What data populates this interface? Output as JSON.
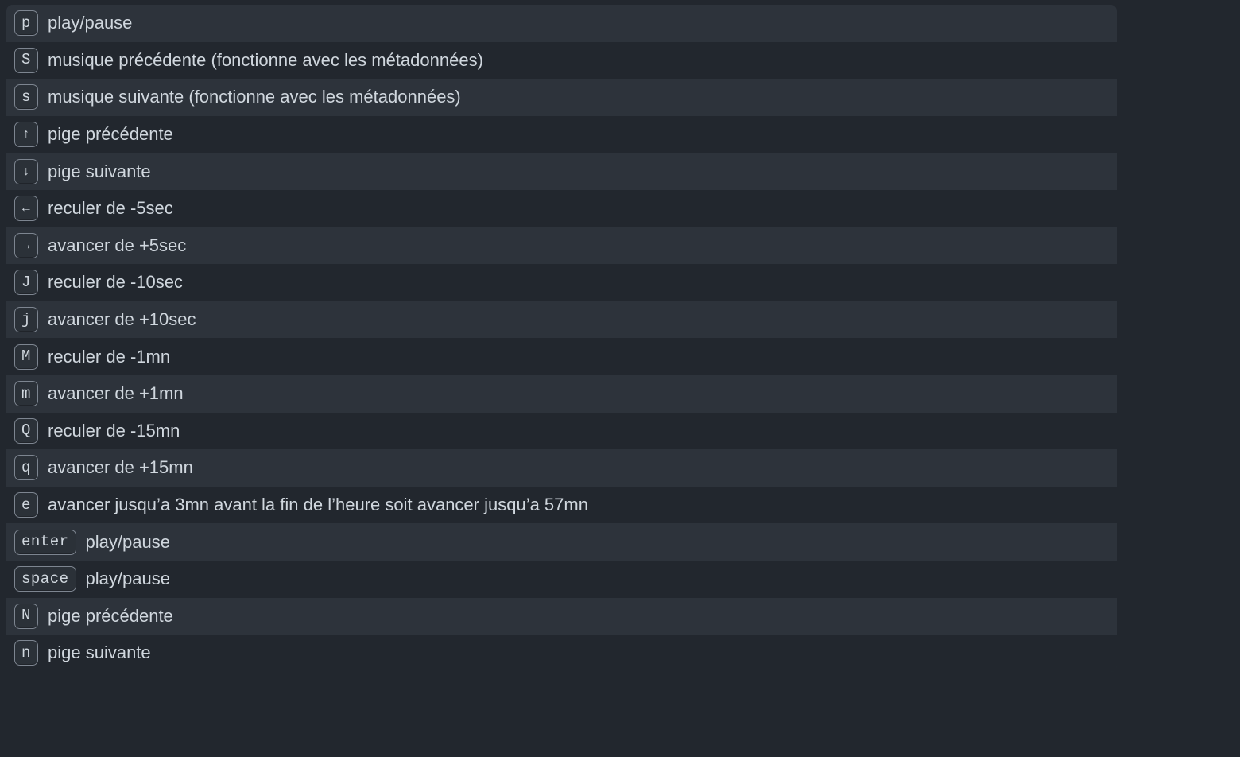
{
  "shortcuts": [
    {
      "key": "p",
      "glyph": "p",
      "desc": "play/pause"
    },
    {
      "key": "S",
      "glyph": "S",
      "desc": "musique précédente (fonctionne avec les métadonnées)"
    },
    {
      "key": "s",
      "glyph": "s",
      "desc": "musique suivante (fonctionne avec les métadonnées)"
    },
    {
      "key": "up",
      "glyph": "↑",
      "desc": "pige précédente"
    },
    {
      "key": "down",
      "glyph": "↓",
      "desc": "pige suivante"
    },
    {
      "key": "left",
      "glyph": "←",
      "desc": "reculer de -5sec"
    },
    {
      "key": "right",
      "glyph": "→",
      "desc": "avancer de +5sec"
    },
    {
      "key": "J",
      "glyph": "J",
      "desc": "reculer de -10sec"
    },
    {
      "key": "j",
      "glyph": "j",
      "desc": "avancer de +10sec"
    },
    {
      "key": "M",
      "glyph": "M",
      "desc": "reculer de -1mn"
    },
    {
      "key": "m",
      "glyph": "m",
      "desc": "avancer de +1mn"
    },
    {
      "key": "Q",
      "glyph": "Q",
      "desc": "reculer de -15mn"
    },
    {
      "key": "q",
      "glyph": "q",
      "desc": "avancer de +15mn"
    },
    {
      "key": "e",
      "glyph": "e",
      "desc": "avancer jusqu’a 3mn avant la fin de l’heure soit avancer jusqu’a 57mn"
    },
    {
      "key": "enter",
      "glyph": "enter",
      "desc": "play/pause"
    },
    {
      "key": "space",
      "glyph": "space",
      "desc": "play/pause"
    },
    {
      "key": "N",
      "glyph": "N",
      "desc": "pige précédente"
    },
    {
      "key": "n",
      "glyph": "n",
      "desc": "pige suivante"
    }
  ]
}
